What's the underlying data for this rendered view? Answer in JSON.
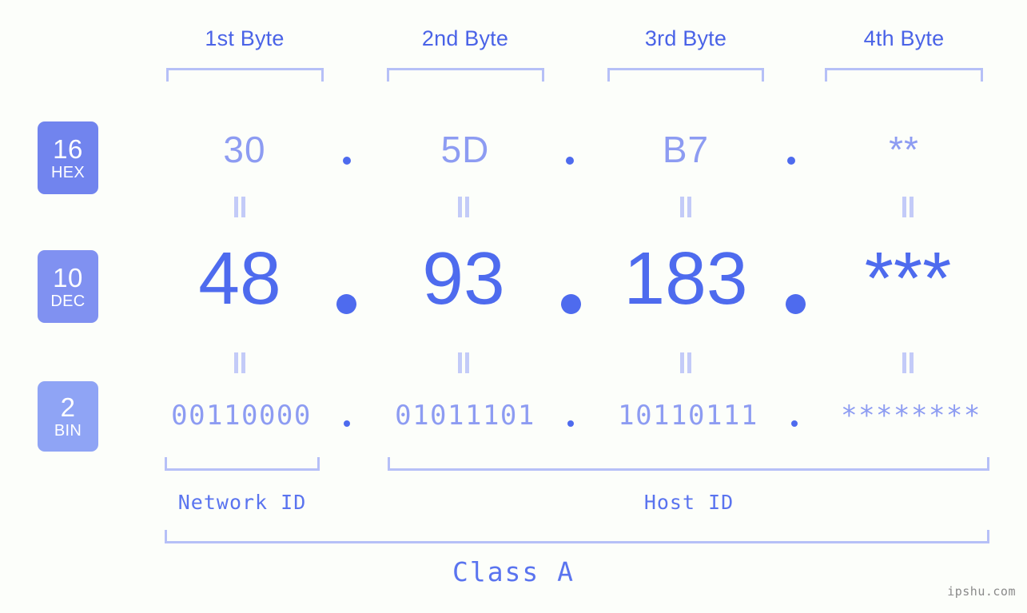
{
  "meta": {
    "background_color": "#fcfefa",
    "accent_strong": "#4e6bee",
    "accent_light": "#8d9cf2",
    "bracket_color": "#b6c0f7",
    "watermark": "ipshu.com"
  },
  "byte_headers": [
    {
      "label": "1st Byte"
    },
    {
      "label": "2nd Byte"
    },
    {
      "label": "3rd Byte"
    },
    {
      "label": "4th Byte"
    }
  ],
  "rows": [
    {
      "id": "hex",
      "badge_number": "16",
      "badge_abbr": "HEX",
      "badge_color": "#7184ee",
      "values": [
        "30",
        "5D",
        "B7",
        "**"
      ],
      "separator": "."
    },
    {
      "id": "dec",
      "badge_number": "10",
      "badge_abbr": "DEC",
      "badge_color": "#8091f1",
      "values": [
        "48",
        "93",
        "183",
        "***"
      ],
      "separator": "."
    },
    {
      "id": "bin",
      "badge_number": "2",
      "badge_abbr": "BIN",
      "badge_color": "#8fa4f5",
      "values": [
        "00110000",
        "01011101",
        "10110111",
        "********"
      ],
      "separator": "."
    }
  ],
  "equals_symbol": "=",
  "footer": {
    "network_id_label": "Network ID",
    "host_id_label": "Host ID",
    "class_label": "Class A"
  }
}
